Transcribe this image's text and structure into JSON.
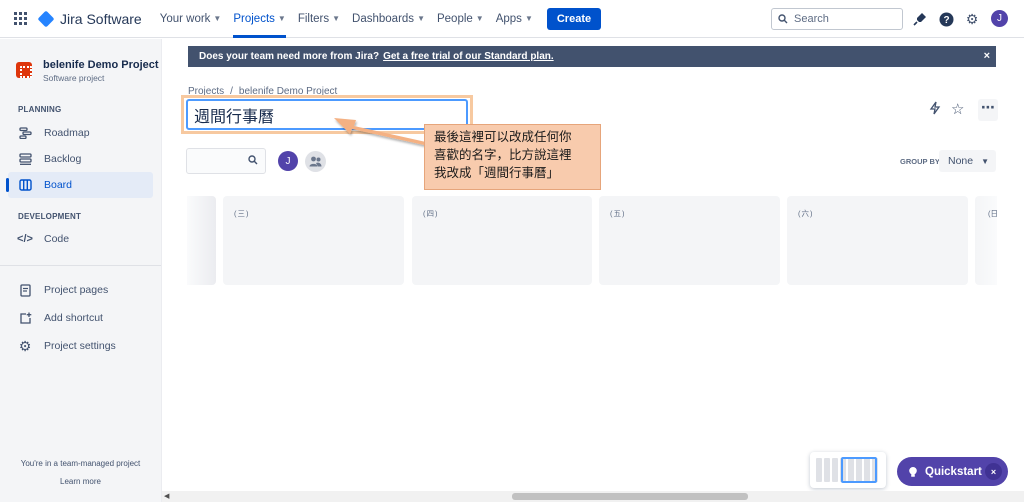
{
  "topnav": {
    "app_name": "Jira Software",
    "items": [
      {
        "label": "Your work",
        "active": false
      },
      {
        "label": "Projects",
        "active": true
      },
      {
        "label": "Filters",
        "active": false
      },
      {
        "label": "Dashboards",
        "active": false
      },
      {
        "label": "People",
        "active": false
      },
      {
        "label": "Apps",
        "active": false
      }
    ],
    "create_label": "Create",
    "search_placeholder": "Search",
    "avatar_initial": "J"
  },
  "sidebar": {
    "project_name": "belenife Demo Project",
    "project_type": "Software project",
    "planning_label": "PLANNING",
    "planning_items": [
      "Roadmap",
      "Backlog",
      "Board"
    ],
    "development_label": "DEVELOPMENT",
    "development_items": [
      "Code"
    ],
    "other_items": [
      "Project pages",
      "Add shortcut",
      "Project settings"
    ],
    "footer_text": "You're in a team-managed project",
    "learn_more": "Learn more"
  },
  "banner": {
    "text": "Does your team need more from Jira?",
    "link": "Get a free trial of our Standard plan.",
    "close": "×"
  },
  "breadcrumb": {
    "projects": "Projects",
    "separator": "/",
    "project": "belenife Demo Project"
  },
  "board": {
    "title_value": "週間行事曆",
    "avatar_initial": "J",
    "group_by_label": "GROUP BY",
    "group_by_value": "None",
    "columns": [
      "(三)",
      "(四)",
      "(五)",
      "(六)"
    ],
    "partial_right_column": "(日"
  },
  "annotation": {
    "lines": [
      "最後這裡可以改成任何你",
      "喜歡的名字，比方說這裡",
      "我改成「週間行事曆」"
    ]
  },
  "quickstart": {
    "label": "Quickstart",
    "close": "×"
  },
  "colors": {
    "brand": "#0052cc",
    "banner_bg": "#42526e",
    "quickstart_bg": "#5243aa",
    "annotation_bg": "#f8cbad"
  }
}
